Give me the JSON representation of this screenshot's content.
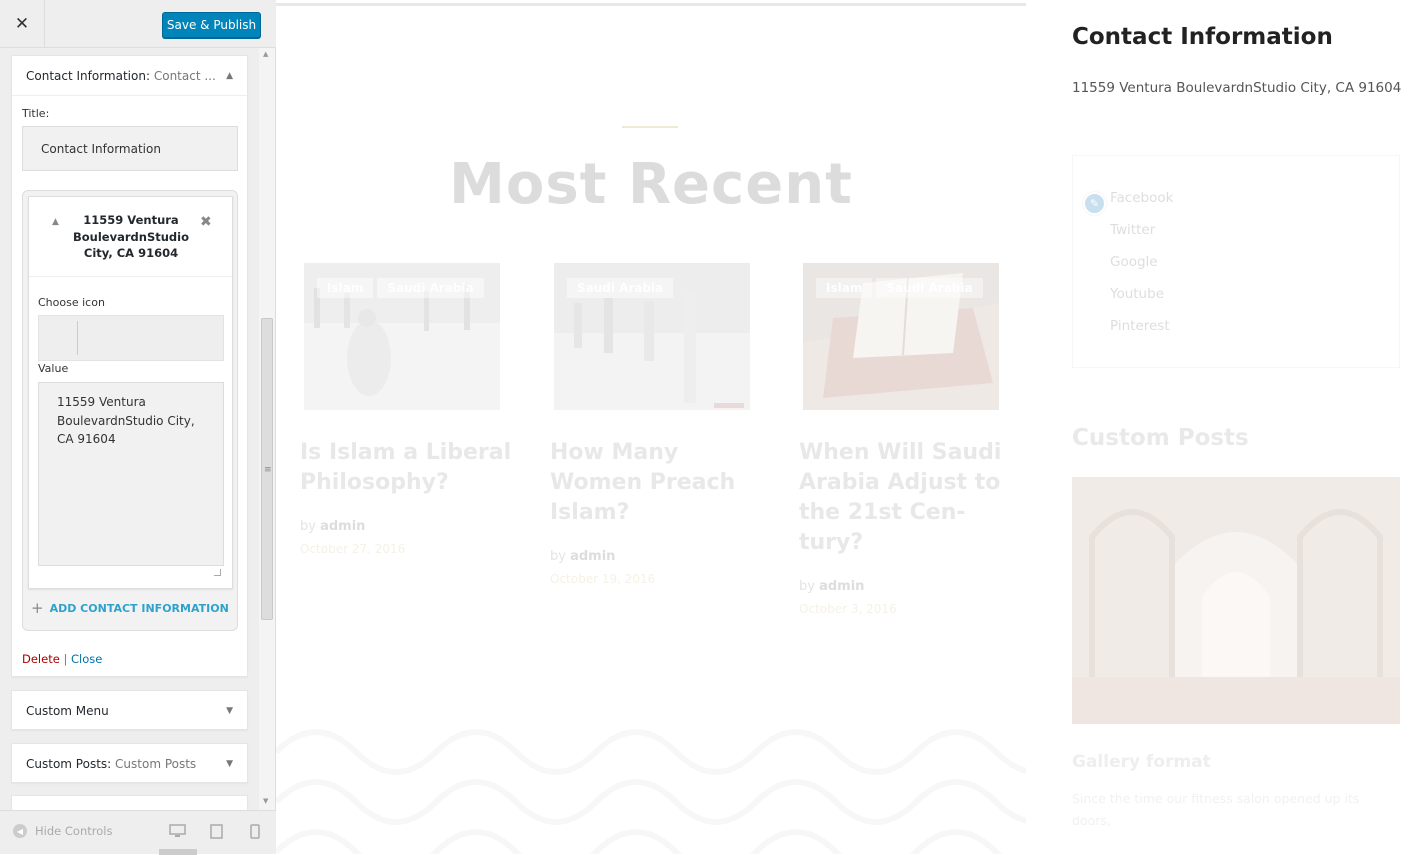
{
  "customizer": {
    "close_icon": "close-icon",
    "publish_label": "Save & Publish",
    "contact_widget": {
      "header_name": "Contact Information:",
      "header_sub": "Contact ...",
      "title_label": "Title:",
      "title_value": "Contact Information",
      "item": {
        "title": "11559 Ventura BoulevardnStudio City, CA 91604",
        "choose_icon_label": "Choose icon",
        "value_label": "Value",
        "value": "11559 Ventura\nBoulevardnStudio City,\nCA 91604"
      },
      "add_label": "ADD CONTACT INFORMATION",
      "delete_label": "Delete",
      "separator": "|",
      "close_label": "Close"
    },
    "menu_widget": {
      "name": "Custom Menu"
    },
    "posts_widget": {
      "name": "Custom Posts:",
      "sub": "Custom Posts"
    },
    "footer": {
      "hide_label": "Hide Controls"
    }
  },
  "preview": {
    "section_title": "Most Recent",
    "posts": [
      {
        "tags": [
          "Islam",
          "Saudi Arabia"
        ],
        "title": "Is Islam a Liberal Philosophy?",
        "by": "by",
        "author": "admin",
        "date": "October 27, 2016"
      },
      {
        "tags": [
          "Saudi Arabia"
        ],
        "title": "How Many Women Preach Islam?",
        "by": "by",
        "author": "admin",
        "date": "October 19, 2016"
      },
      {
        "tags": [
          "Islam",
          "Saudi Arabia"
        ],
        "title": "When Will Saudi Arabia Adjust to the 21st Cen-tury?",
        "by": "by",
        "author": "admin",
        "date": "October 3, 2016"
      }
    ],
    "contact": {
      "title": "Contact Information",
      "address": "11559 Ventura BoulevardnStudio City, CA 91604"
    },
    "social": [
      "Facebook",
      "Twitter",
      "Google",
      "Youtube",
      "Pinterest"
    ],
    "custom_posts": {
      "title": "Custom Posts",
      "item_title": "Gallery format",
      "item_text": "Since the time our fitness salon opened up its doors,"
    }
  },
  "colors": {
    "publish": "#0085ba",
    "link": "#0073aa",
    "delete": "#aa0000",
    "add": "#2ea2cc"
  }
}
